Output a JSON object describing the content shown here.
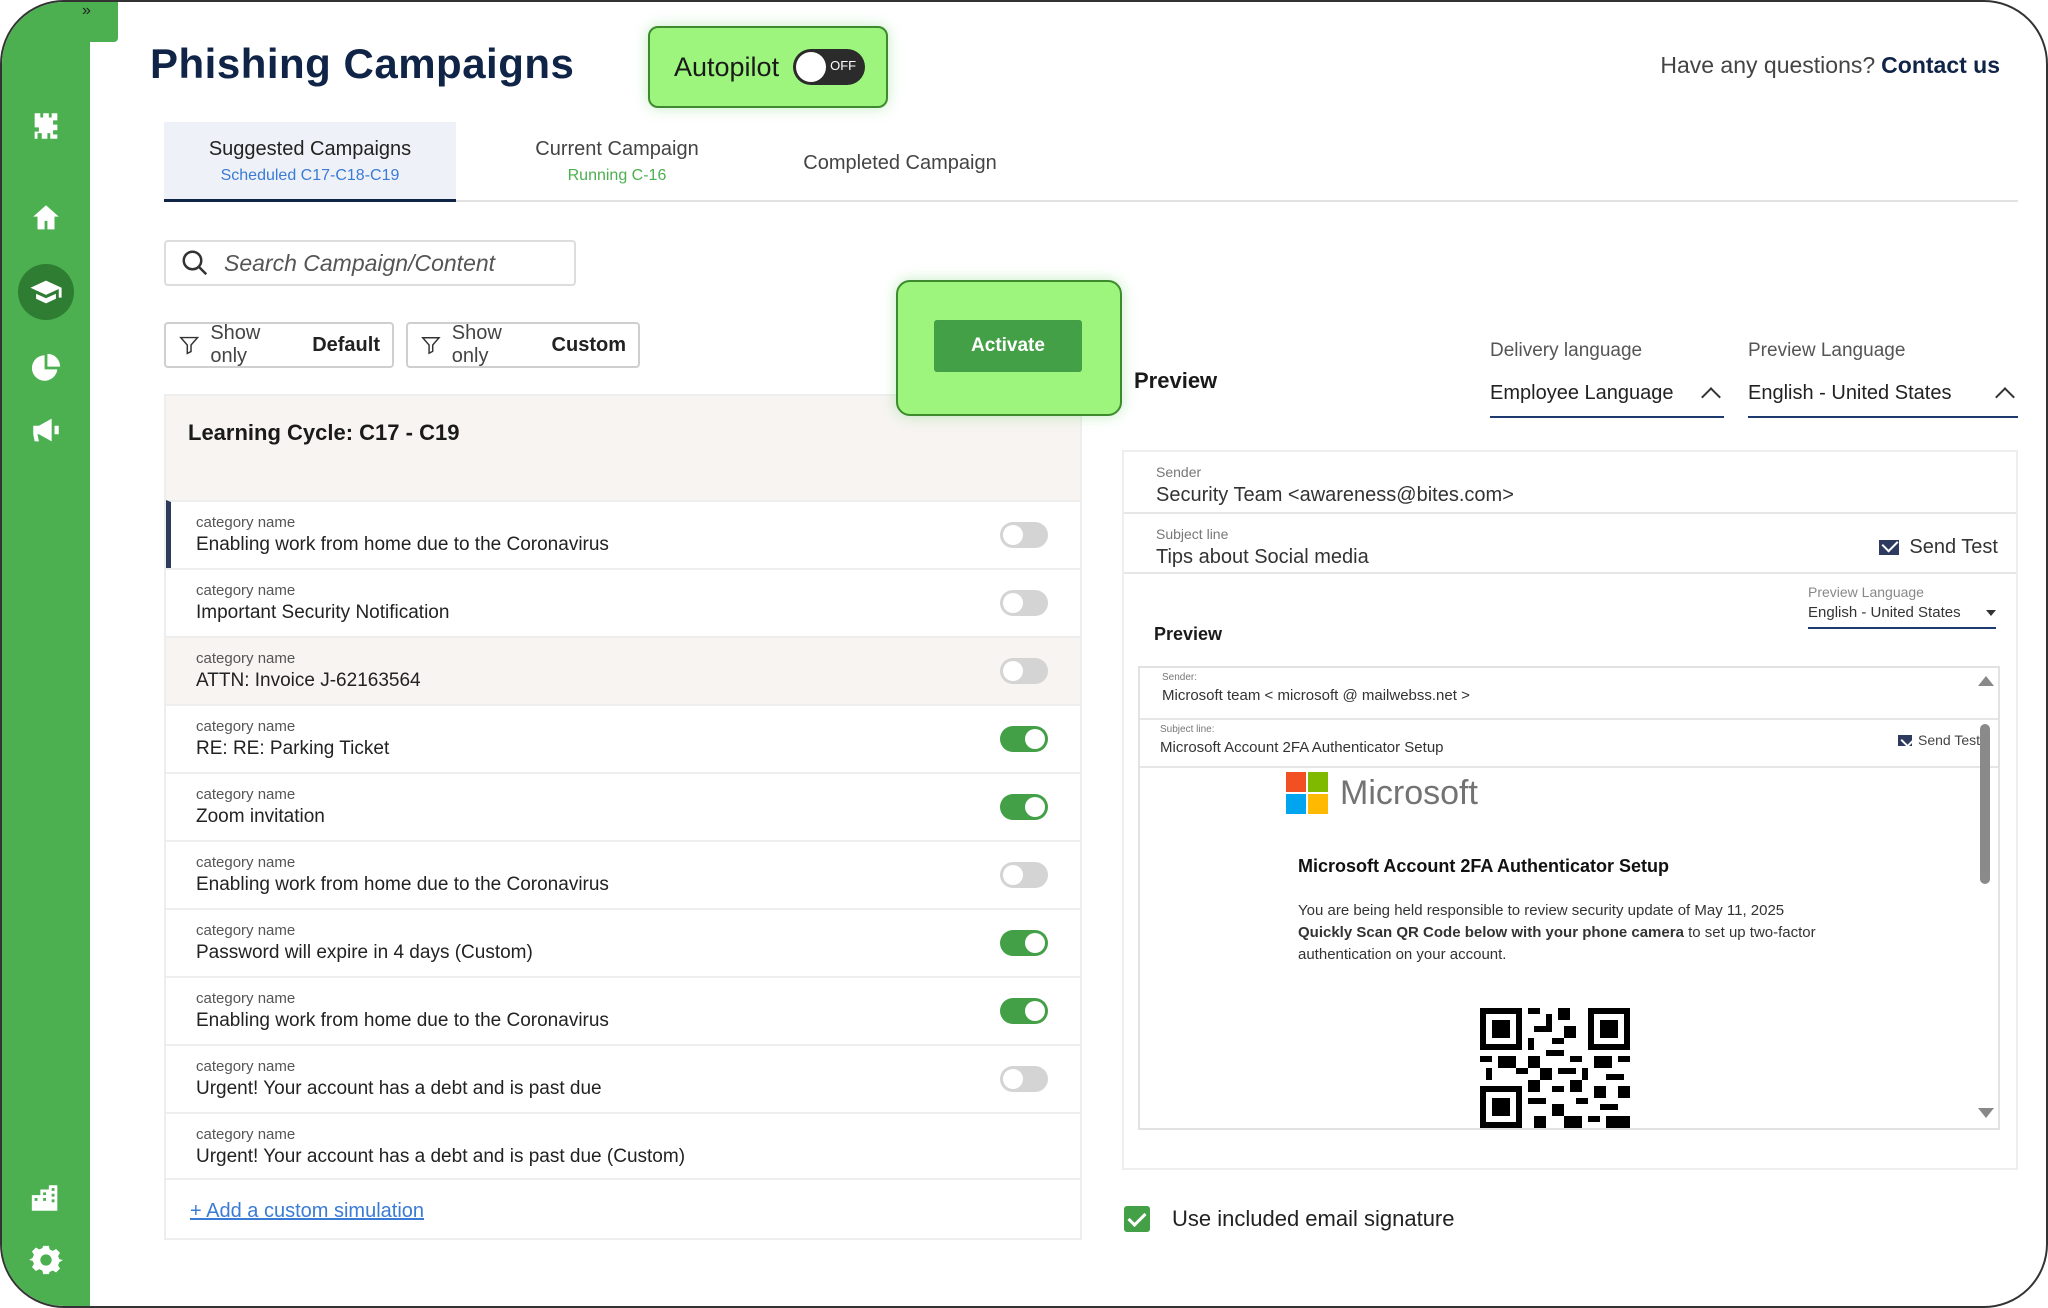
{
  "page": {
    "title": "Phishing Campaigns"
  },
  "autopilot": {
    "label": "Autopilot",
    "state": "OFF"
  },
  "help": {
    "question": "Have any questions?",
    "link": "Contact us"
  },
  "tabs": [
    {
      "label": "Suggested Campaigns",
      "sub": "Scheduled C17-C18-C19",
      "sub_color": "#3a7bd5",
      "active": true
    },
    {
      "label": "Current Campaign",
      "sub": "Running C-16",
      "sub_color": "#4caf50",
      "active": false
    },
    {
      "label": "Completed Campaign",
      "sub": "",
      "active": false
    }
  ],
  "search": {
    "placeholder": "Search Campaign/Content"
  },
  "filters": [
    {
      "prefix": "Show only",
      "value": "Default"
    },
    {
      "prefix": "Show only",
      "value": "Custom"
    }
  ],
  "activate": {
    "label": "Activate"
  },
  "cycle": {
    "title": "Learning Cycle: C17 - C19"
  },
  "campaigns": [
    {
      "category": "category name",
      "name": "Enabling work from home due to the Coronavirus",
      "enabled": false
    },
    {
      "category": "category name",
      "name": "Important Security Notification",
      "enabled": false
    },
    {
      "category": "category name",
      "name": "ATTN: Invoice J-62163564",
      "enabled": false
    },
    {
      "category": "category name",
      "name": "RE: RE: Parking Ticket",
      "enabled": true
    },
    {
      "category": "category name",
      "name": "Zoom invitation",
      "enabled": true
    },
    {
      "category": "category name",
      "name": "Enabling work from home due to the Coronavirus",
      "enabled": false
    },
    {
      "category": "category name",
      "name": "Password will expire in 4 days (Custom)",
      "enabled": true
    },
    {
      "category": "category name",
      "name": "Enabling work from home due to the Coronavirus",
      "enabled": true
    },
    {
      "category": "category name",
      "name": "Urgent! Your account has a debt and is past due",
      "enabled": false
    },
    {
      "category": "category name",
      "name": "Urgent! Your account has a debt and is past due (Custom)",
      "enabled": null
    }
  ],
  "add_simulation": "+ Add a custom simulation",
  "preview": {
    "title": "Preview",
    "delivery_language": {
      "label": "Delivery language",
      "value": "Employee Language"
    },
    "preview_language": {
      "label": "Preview Language",
      "value": "English - United States"
    },
    "sender": {
      "label": "Sender",
      "value": "Security Team <awareness@bites.com>"
    },
    "subject": {
      "label": "Subject line",
      "value": "Tips about Social media"
    },
    "send_test": "Send Test",
    "inner": {
      "title": "Preview",
      "language_label": "Preview Language",
      "language_value": "English - United States",
      "sender_label": "Sender:",
      "sender_value": "Microsoft team < microsoft @ mailwebss.net >",
      "subject_label": "Subject line:",
      "subject_value": "Microsoft Account 2FA Authenticator Setup",
      "send_test": "Send Test",
      "brand": "Microsoft",
      "heading": "Microsoft Account 2FA Authenticator Setup",
      "body_1": "You are being held responsible to review security update of May 11, 2025",
      "body_bold": "Quickly Scan QR Code below with your phone camera",
      "body_2": " to set up two-factor authentication on your account."
    }
  },
  "signature": {
    "label": "Use included email signature",
    "checked": true
  },
  "colors": {
    "sidebar": "#4caf50",
    "highlight": "#9df57d",
    "navy": "#0f2447",
    "toggle_on": "#43a047"
  },
  "sidebar_icons": [
    "logo-icon",
    "home-icon",
    "graduation-cap-icon",
    "pie-chart-icon",
    "megaphone-icon",
    "buildings-icon",
    "gear-icon"
  ]
}
